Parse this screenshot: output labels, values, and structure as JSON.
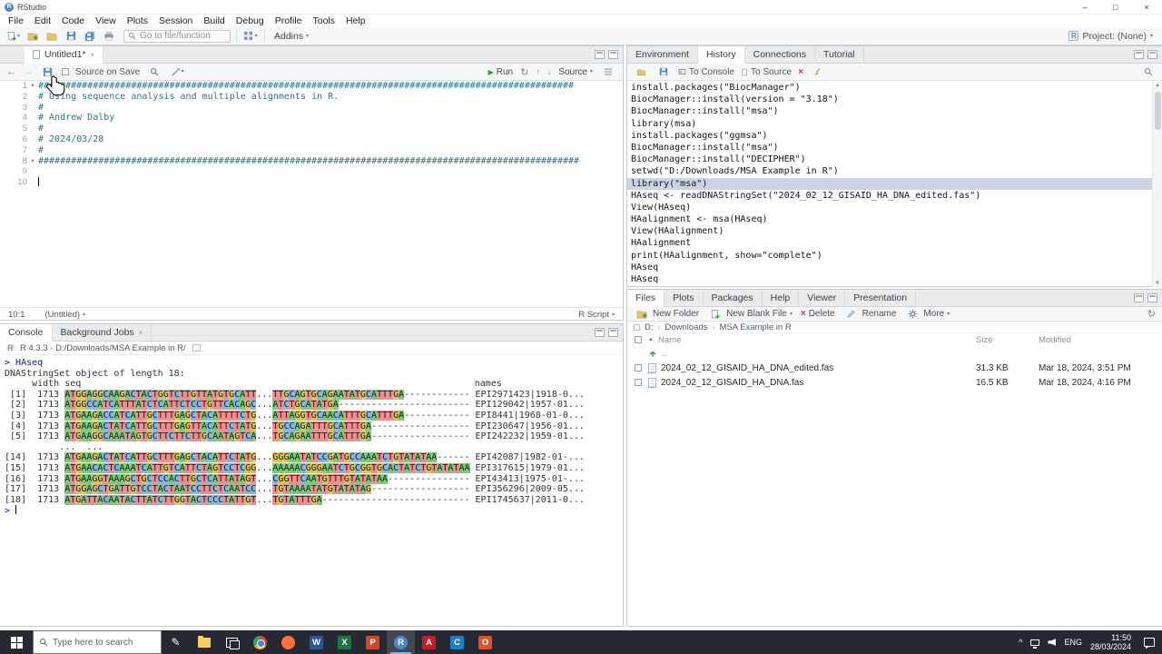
{
  "window": {
    "title": "RStudio",
    "controls": {
      "minimize": "–",
      "maximize": "□",
      "close": "×"
    },
    "menu": [
      "File",
      "Edit",
      "Code",
      "View",
      "Plots",
      "Session",
      "Build",
      "Debug",
      "Profile",
      "Tools",
      "Help"
    ],
    "toolbar": {
      "icons": [
        {
          "name": "new-file",
          "caret": true
        },
        {
          "name": "new-project"
        },
        {
          "name": "open-file"
        },
        {
          "name": "save"
        },
        {
          "name": "save-all"
        },
        {
          "name": "print"
        }
      ],
      "goto_placeholder": "Go to file/function",
      "addins_label": "Addins",
      "project_label": "Project: (None)"
    }
  },
  "icons": {
    "caret": "▾",
    "close": "×",
    "refresh": "↻",
    "back": "←",
    "forward": "→",
    "run_play": "▶",
    "up": "↑",
    "down": "↓",
    "fold": "▾",
    "sort_asc": "▲",
    "breadcrumb_sep": "›",
    "tray_expand": "^",
    "prompt": ">"
  },
  "source_pane": {
    "tab_label": "Untitled1*",
    "toolbar": {
      "source_on_save": "Source on Save",
      "run_label": "Run",
      "source_label": "Source"
    },
    "lines": [
      "##################################################################################################",
      "# Using sequence analysis and multiple alignments in R.",
      "#",
      "# Andrew Dalby",
      "#",
      "# 2024/03/28",
      "#",
      "###################################################################################################",
      "",
      ""
    ],
    "fold_lines": [
      1,
      8
    ],
    "cursor_line": 10,
    "status": {
      "position": "10:1",
      "doc_name": "(Untitled)",
      "doc_type": "R Script"
    }
  },
  "console_pane": {
    "tabs": [
      {
        "label": "Console",
        "active": true,
        "closable": false
      },
      {
        "label": "Background Jobs",
        "active": false,
        "closable": true
      }
    ],
    "header": "R 4.3.3 · D:/Downloads/MSA Example in R/",
    "prompt": "> ",
    "first_input": "HAseq",
    "intro": "DNAStringSet object of length 18:",
    "col_header_left": "     width seq",
    "col_header_right": "names",
    "name_col": 86,
    "ellipsis_row": "          ...  ...",
    "rows": [
      {
        "label": " [1]",
        "width": "1713",
        "seq1": "ATGGAGGCAAGACTACTGGTCTTGTTATGTGCATT",
        "seq2": "TTGCAGTGCAGAATATGCATTTGA------------",
        "name": "EPI2971423|1918-0..."
      },
      {
        "label": " [2]",
        "width": "1713",
        "seq1": "ATGGCCATCATTTATCTCATTCTCCTGTTCACAGC",
        "seq2": "ATCTGCATATGA------------------------",
        "name": "EPI129042|1957-01..."
      },
      {
        "label": " [3]",
        "width": "1713",
        "seq1": "ATGAAGACCATCATTGCTTTGAGCTACATTTTCTG",
        "seq2": "ATTAGGTGCAACATTTGCATTTGA------------",
        "name": "EPI8441|1968-01-0..."
      },
      {
        "label": " [4]",
        "width": "1713",
        "seq1": "ATGAAGACTATCATTGCTTTGAGTTACATTCTATG",
        "seq2": "TGCCAGATTTGCATTTGA------------------",
        "name": "EPI230647|1956-01..."
      },
      {
        "label": " [5]",
        "width": "1713",
        "seq1": "ATGAAGGCAAATAGTGCTTCTTCTTGCAATAGTCA",
        "seq2": "TGCAGAATTTGCATTTGA------------------",
        "name": "EPI242232|1959-01..."
      },
      {
        "label": "[14]",
        "width": "1713",
        "seq1": "ATGAAGACTATCATTGCTTTGAGCTACATTCTATG",
        "seq2": "GGGAATATCCGATGCCAAATCTGTATATAA------",
        "name": "EPI42087|1982-01-..."
      },
      {
        "label": "[15]",
        "width": "1713",
        "seq1": "ATGAACACTCAAATCATTGTCATTCTAGTCCTCGG",
        "seq2": "AAAAACGGGAATCTGCGGTGCACTATCTGTATATAA",
        "name": "EPI317615|1979-01..."
      },
      {
        "label": "[16]",
        "width": "1713",
        "seq1": "ATGAAGGTAAAGCTGCTCCACTTGCTCATTATAGT",
        "seq2": "CGGTTCAATGTTTGTATATAA---------------",
        "name": "EPI43413|1975-01-..."
      },
      {
        "label": "[17]",
        "width": "1713",
        "seq1": "ATGGAGCTGATTGTCCTACTAATCCTTCTCAATCC",
        "seq2": "TGTAAAATATGTATATAG------------------",
        "name": "EPI356296|2009-05..."
      },
      {
        "label": "[18]",
        "width": "1713",
        "seq1": "ATGATTACAATACTTATCTTGGTACTCCCTATTGT",
        "seq2": "TGTATTTGA---------------------------",
        "name": "EPI1745637|2011-0..."
      }
    ]
  },
  "environment_pane": {
    "tabs": [
      "Environment",
      "History",
      "Connections",
      "Tutorial"
    ],
    "active_tab": 1,
    "toolbar": {
      "to_console_label": "To Console",
      "to_source_label": "To Source"
    },
    "selected_index": 8,
    "history": [
      "install.packages(\"BiocManager\")",
      "BiocManager::install(version = \"3.18\")",
      "BiocManager::install(\"msa\")",
      "library(msa)",
      "install.packages(\"ggmsa\")",
      "BiocManager::install(\"msa\")",
      "BiocManager::install(\"DECIPHER\")",
      "setwd(\"D:/Downloads/MSA Example in R\")",
      "library(\"msa\")",
      "HAseq <- readDNAStringSet(\"2024_02_12_GISAID_HA_DNA_edited.fas\")",
      "View(HAseq)",
      "HAalignment <- msa(HAseq)",
      "View(HAalignment)",
      "HAalignment",
      "print(HAalignment, show=\"complete\")",
      "HAseq",
      "HAseq"
    ]
  },
  "files_pane": {
    "tabs": [
      "Files",
      "Plots",
      "Packages",
      "Help",
      "Viewer",
      "Presentation"
    ],
    "active_tab": 0,
    "toolbar": [
      {
        "name": "new-folder",
        "label": "New Folder"
      },
      {
        "name": "new-blank-file",
        "label": "New Blank File",
        "caret": true
      },
      {
        "name": "delete",
        "label": "Delete"
      },
      {
        "name": "rename",
        "label": "Rename"
      },
      {
        "name": "more",
        "label": "More",
        "caret": true
      }
    ],
    "breadcrumb": [
      "D:",
      "Downloads",
      "MSA Example in R"
    ],
    "columns": {
      "name": "Name",
      "size": "Size",
      "modified": "Modified"
    },
    "updir_label": "..",
    "files": [
      {
        "name": "2024_02_12_GISAID_HA_DNA_edited.fas",
        "size": "31.3 KB",
        "modified": "Mar 18, 2024, 3:51 PM"
      },
      {
        "name": "2024_02_12_GISAID_HA_DNA.fas",
        "size": "16.5 KB",
        "modified": "Mar 18, 2024, 4:16 PM"
      }
    ]
  },
  "taskbar": {
    "search_placeholder": "Type here to search",
    "apps": [
      {
        "name": "windows-ink",
        "style": "glyph",
        "glyph": "✎"
      },
      {
        "name": "file-explorer",
        "style": "folder"
      },
      {
        "name": "task-view",
        "style": "taskview"
      },
      {
        "name": "chrome",
        "style": "chrome"
      },
      {
        "name": "firefox",
        "style": "circle",
        "color": "#ff7139"
      },
      {
        "name": "word",
        "style": "letter",
        "letter": "W",
        "color": "#2b579a"
      },
      {
        "name": "excel",
        "style": "letter",
        "letter": "X",
        "color": "#217346"
      },
      {
        "name": "powerpoint",
        "style": "letter",
        "letter": "P",
        "color": "#d24726"
      },
      {
        "name": "rstudio",
        "style": "letter-circle",
        "letter": "R",
        "color": "#4f87c7",
        "active": true
      },
      {
        "name": "acrobat",
        "style": "letter",
        "letter": "A",
        "color": "#c21f25"
      },
      {
        "name": "vscode",
        "style": "letter",
        "letter": "C",
        "color": "#1f7fc4"
      },
      {
        "name": "outlook",
        "style": "letter",
        "letter": "O",
        "color": "#d9532c"
      }
    ],
    "tray": {
      "language": "ENG",
      "time": "11:50",
      "date": "28/03/2024"
    }
  },
  "colors": {
    "nt": {
      "A": "#7fc97f",
      "C": "#87b7dc",
      "G": "#d9c465",
      "T": "#ef8e8e"
    },
    "selection": "#c9d4e4",
    "comment": "#2b7587",
    "console_input": "#0d16b5",
    "taskbar": "#252933",
    "accent_blue": "#4f87c7"
  }
}
